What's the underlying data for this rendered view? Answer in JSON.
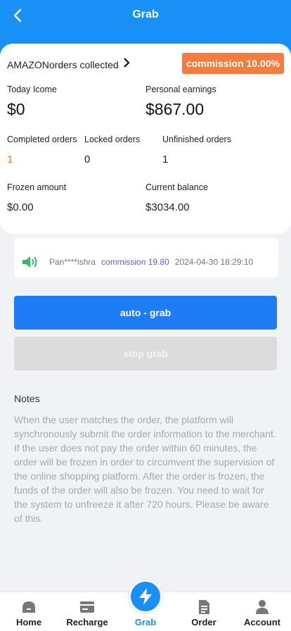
{
  "header": {
    "title": "Grab"
  },
  "summary": {
    "collected_label": "AMAZONorders collected",
    "commission_badge": "commission 10.00%",
    "today_income_label": "Today Icome",
    "today_income_value": "$0",
    "personal_earnings_label": "Personal earnings",
    "personal_earnings_value": "$867.00",
    "completed_label": "Completed orders",
    "completed_value": "1",
    "locked_label": "Locked orders",
    "locked_value": "0",
    "unfinished_label": "Unfinished orders",
    "unfinished_value": "1",
    "frozen_label": "Frozen amount",
    "frozen_value": "$0.00",
    "balance_label": "Current balance",
    "balance_value": "$3034.00"
  },
  "ticker": {
    "user": "Pan****ishra",
    "commission": "commission 19.80",
    "time": "2024-04-30 18:29:10"
  },
  "buttons": {
    "auto_grab": "auto - grab",
    "stop_grab": "stop grab"
  },
  "notes": {
    "title": "Notes",
    "body": "When the user matches the order, the platform will synchronously submit the order information to the merchant. If the user does not pay the order within 60  minutes, the order will be frozen in order to circumvent the supervision of the online shopping platform. After the order is frozen, the funds of the order will also be frozen. You need to wait for the system to unfreeze it after 720 hours. Please be aware of this."
  },
  "tabbar": {
    "home": "Home",
    "recharge": "Recharge",
    "grab": "Grab",
    "order": "Order",
    "account": "Account"
  },
  "colors": {
    "primary": "#1890f5",
    "button_blue": "#1e7cf7",
    "accent_orange": "#f47c3c"
  }
}
